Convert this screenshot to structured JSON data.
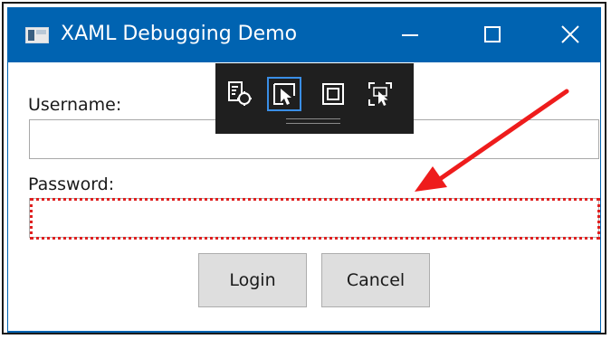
{
  "window": {
    "title": "XAML Debugging Demo",
    "accent_color": "#0063b1",
    "caption_buttons": [
      "minimize-icon",
      "maximize-icon",
      "close-icon"
    ]
  },
  "form": {
    "username_label": "Username:",
    "username_value": "",
    "password_label": "Password:",
    "password_value": "",
    "login_label": "Login",
    "cancel_label": "Cancel"
  },
  "debug_toolbar": {
    "tools": [
      "live-visual-tree-icon",
      "select-element-icon",
      "display-adorners-icon",
      "track-focus-icon"
    ],
    "selected_tool": "select-element-icon",
    "selected_color": "#3a8ee6"
  },
  "annotation": {
    "highlight_color": "#e02020",
    "arrow_color": "#ee1c1c"
  }
}
